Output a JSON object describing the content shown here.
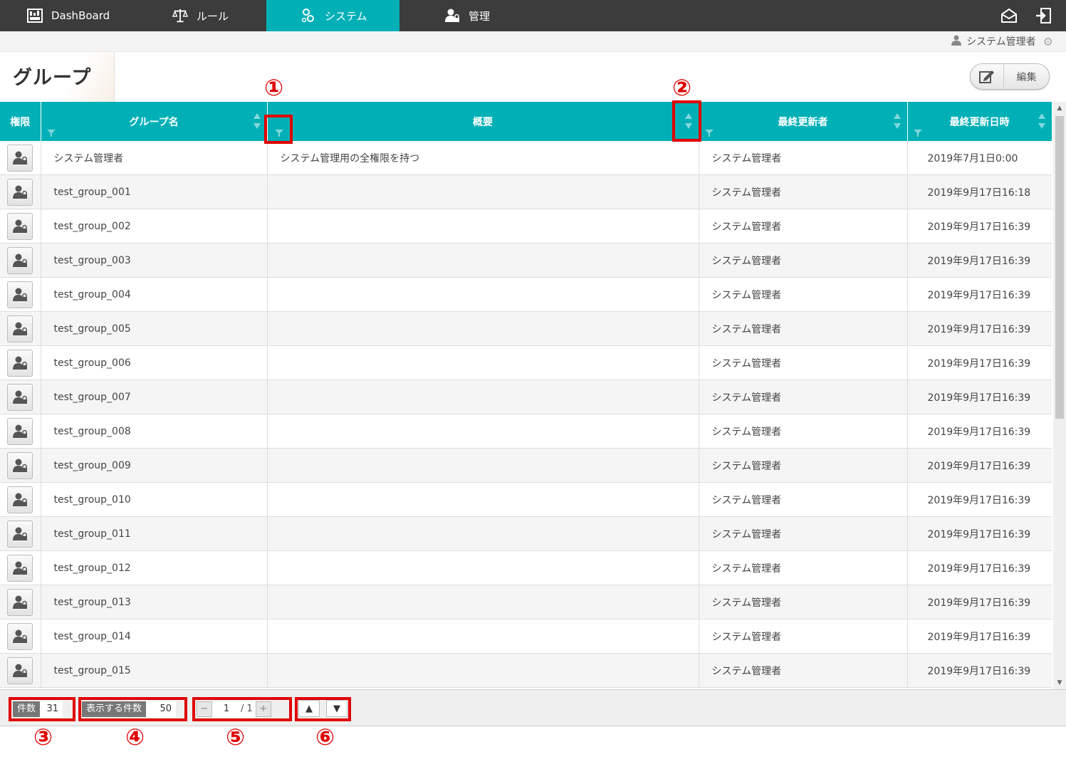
{
  "nav": {
    "items": [
      {
        "label": "DashBoard",
        "icon": "dashboard-icon"
      },
      {
        "label": "ルール",
        "icon": "scale-icon"
      },
      {
        "label": "システム",
        "icon": "gears-icon"
      },
      {
        "label": "管理",
        "icon": "user-lock-icon"
      }
    ],
    "active_index": 2,
    "right_icons": [
      "mail-icon",
      "logout-icon"
    ]
  },
  "user": {
    "name": "システム管理者"
  },
  "page": {
    "title": "グループ",
    "edit_label": "編集"
  },
  "table": {
    "columns": [
      "権限",
      "グループ名",
      "概要",
      "最終更新者",
      "最終更新日時"
    ],
    "rows": [
      [
        "システム管理者",
        "システム管理用の全権限を持つ",
        "システム管理者",
        "2019年7月1日0:00"
      ],
      [
        "test_group_001",
        "",
        "システム管理者",
        "2019年9月17日16:18"
      ],
      [
        "test_group_002",
        "",
        "システム管理者",
        "2019年9月17日16:39"
      ],
      [
        "test_group_003",
        "",
        "システム管理者",
        "2019年9月17日16:39"
      ],
      [
        "test_group_004",
        "",
        "システム管理者",
        "2019年9月17日16:39"
      ],
      [
        "test_group_005",
        "",
        "システム管理者",
        "2019年9月17日16:39"
      ],
      [
        "test_group_006",
        "",
        "システム管理者",
        "2019年9月17日16:39"
      ],
      [
        "test_group_007",
        "",
        "システム管理者",
        "2019年9月17日16:39"
      ],
      [
        "test_group_008",
        "",
        "システム管理者",
        "2019年9月17日16:39"
      ],
      [
        "test_group_009",
        "",
        "システム管理者",
        "2019年9月17日16:39"
      ],
      [
        "test_group_010",
        "",
        "システム管理者",
        "2019年9月17日16:39"
      ],
      [
        "test_group_011",
        "",
        "システム管理者",
        "2019年9月17日16:39"
      ],
      [
        "test_group_012",
        "",
        "システム管理者",
        "2019年9月17日16:39"
      ],
      [
        "test_group_013",
        "",
        "システム管理者",
        "2019年9月17日16:39"
      ],
      [
        "test_group_014",
        "",
        "システム管理者",
        "2019年9月17日16:39"
      ],
      [
        "test_group_015",
        "",
        "システム管理者",
        "2019年9月17日16:39"
      ]
    ]
  },
  "footer": {
    "count_label": "件数",
    "count_value": "31",
    "per_page_label": "表示する件数",
    "per_page_value": "50",
    "page_minus": "−",
    "page_current": "1",
    "page_total": "/ 1",
    "page_plus": "+",
    "up": "▲",
    "down": "▼"
  },
  "annotations": [
    "①",
    "②",
    "③",
    "④",
    "⑤",
    "⑥"
  ],
  "colors": {
    "teal": "#00b0b6",
    "nav_bg": "#3c3c3c",
    "highlight": "#e00000"
  }
}
